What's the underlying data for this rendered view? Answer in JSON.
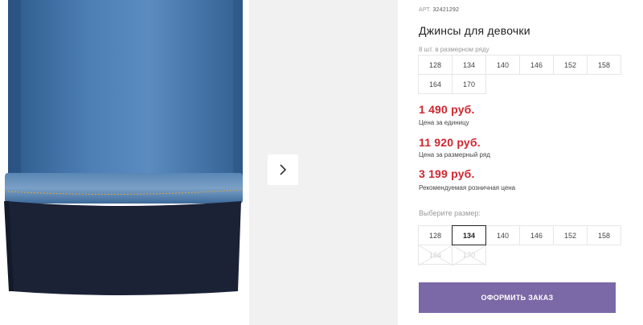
{
  "product": {
    "art_label": "АРТ.",
    "art_number": "32421292",
    "title": "Джинсы для девочки",
    "size_row_note": "8 шт. в размерном ряду",
    "size_row": [
      "128",
      "134",
      "140",
      "146",
      "152",
      "158",
      "164",
      "170"
    ]
  },
  "prices": {
    "unit_price": "1 490 руб.",
    "unit_label": "Цена за единицу",
    "row_price": "11 920 руб.",
    "row_label": "Цена за размерный ряд",
    "retail_price": "3 199 руб.",
    "retail_label": "Рекомендуемая розничная цена"
  },
  "size_select": {
    "label": "Выберите размер:",
    "options": [
      {
        "value": "128",
        "state": "available"
      },
      {
        "value": "134",
        "state": "selected"
      },
      {
        "value": "140",
        "state": "available"
      },
      {
        "value": "146",
        "state": "available"
      },
      {
        "value": "152",
        "state": "available"
      },
      {
        "value": "158",
        "state": "available"
      },
      {
        "value": "164",
        "state": "disabled"
      },
      {
        "value": "170",
        "state": "disabled"
      }
    ]
  },
  "actions": {
    "order_button": "ОФОРМИТЬ ЗАКАЗ"
  },
  "colors": {
    "price": "#d0252f",
    "order_button_bg": "#7b68a6",
    "denim": "#3f6fa3",
    "lining": "#1b2236"
  },
  "icons": {
    "gallery_next": "chevron-right-icon"
  }
}
